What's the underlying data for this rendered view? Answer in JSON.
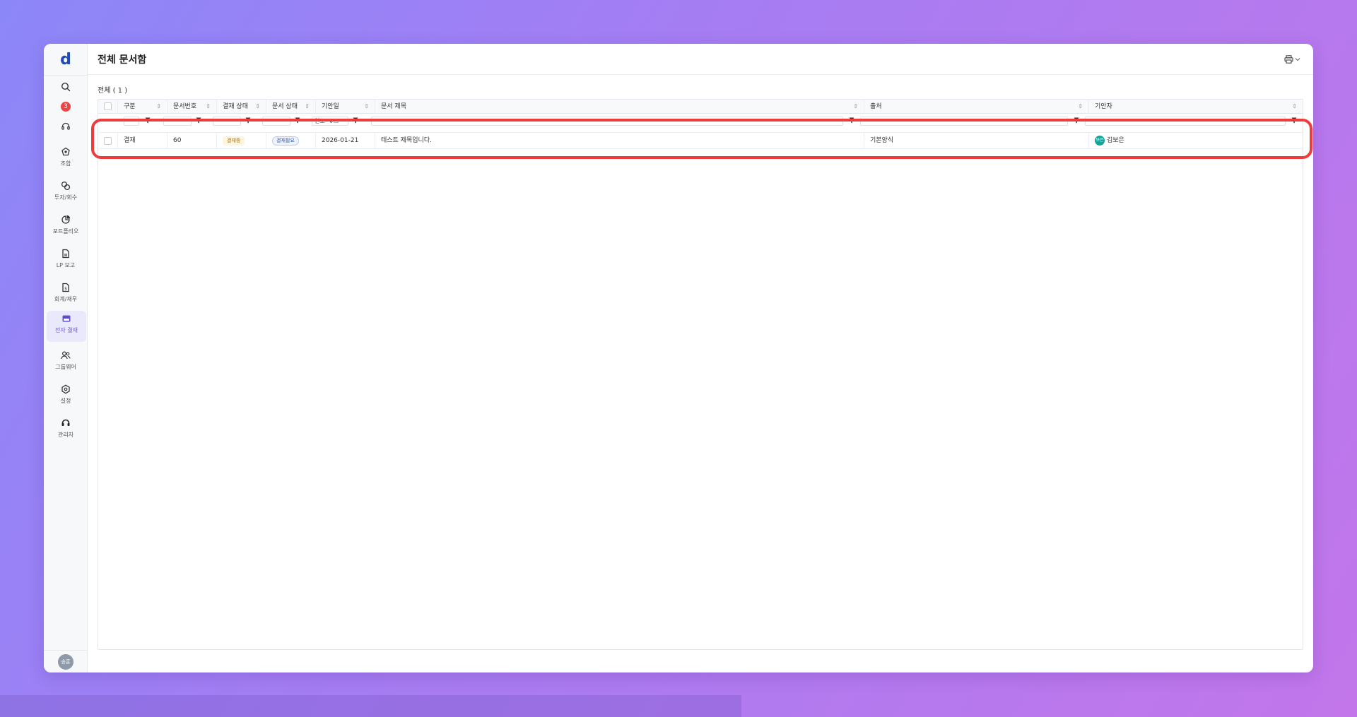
{
  "app": {
    "logo": "d",
    "notification_count": "3",
    "user_avatar": "승훈"
  },
  "sidebar": {
    "items": [
      {
        "label": "조합",
        "icon": "fund-icon"
      },
      {
        "label": "투자/회수",
        "icon": "investment-icon"
      },
      {
        "label": "포트폴리오",
        "icon": "portfolio-icon"
      },
      {
        "label": "LP 보고",
        "icon": "report-icon"
      },
      {
        "label": "회계/재무",
        "icon": "accounting-icon"
      },
      {
        "label": "전자 결재",
        "icon": "approval-icon",
        "active": true
      },
      {
        "label": "그룹웨어",
        "icon": "groupware-icon"
      },
      {
        "label": "설정",
        "icon": "settings-icon"
      },
      {
        "label": "관리자",
        "icon": "admin-icon"
      }
    ]
  },
  "header": {
    "title": "전체 문서함"
  },
  "list": {
    "count_label": "전체 ( 1 )"
  },
  "table": {
    "columns": [
      "구분",
      "문서번호",
      "결재 상태",
      "문서 상태",
      "기안일",
      "문서 제목",
      "출처",
      "기안자"
    ],
    "date_filter_placeholder": "연도-",
    "rows": [
      {
        "type": "결재",
        "doc_no": "60",
        "approval_status": "결재중",
        "doc_status": "결재필요",
        "draft_date": "2026-01-21",
        "title": "테스트 제목입니다.",
        "source": "기본양식",
        "drafter_initials": "보은",
        "drafter": "김보은"
      }
    ]
  },
  "colors": {
    "highlight": "#ee3b3b",
    "accent": "#6b5bd6",
    "badge": "#ef4444"
  }
}
